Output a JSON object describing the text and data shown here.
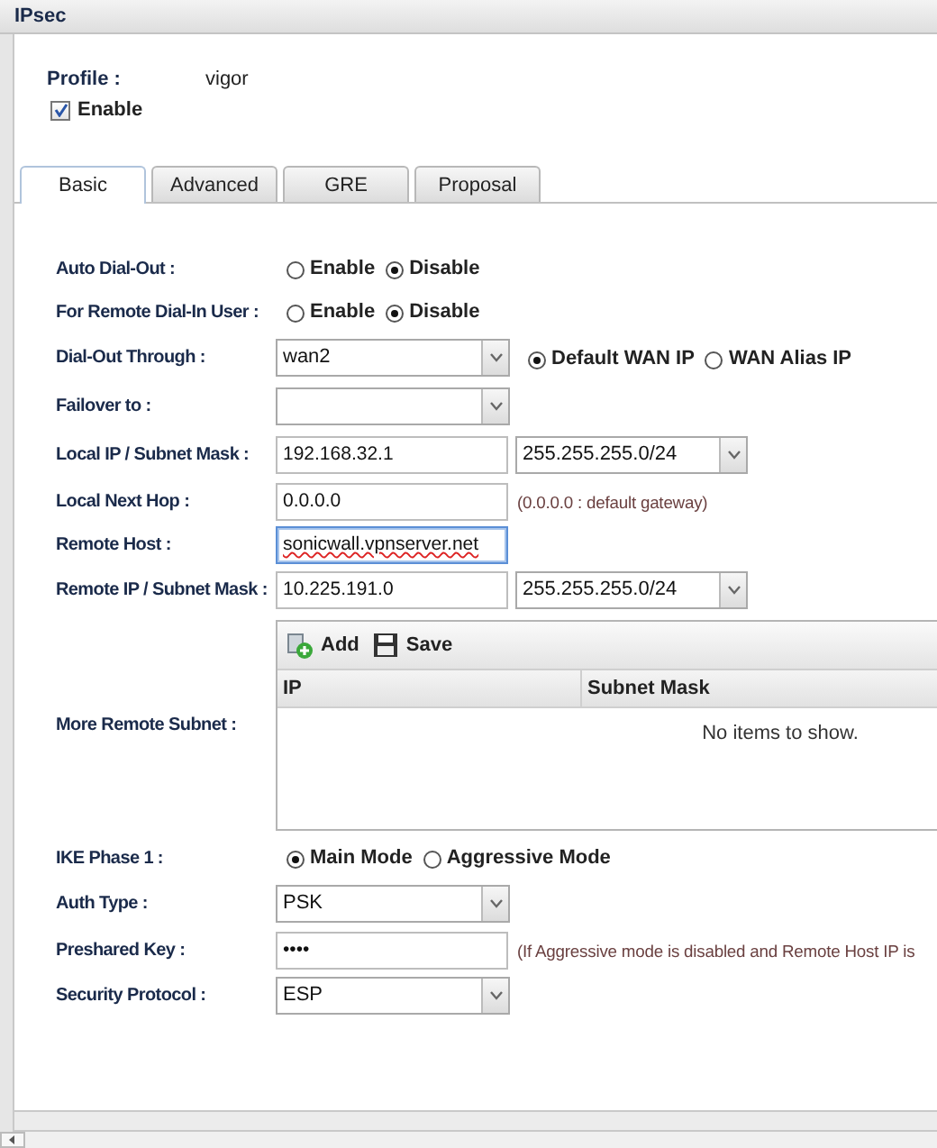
{
  "window": {
    "title": "IPsec"
  },
  "profile": {
    "label": "Profile :",
    "value": "vigor"
  },
  "enable": {
    "label": "Enable",
    "checked": true
  },
  "tabs": [
    {
      "label": "Basic",
      "selected": true
    },
    {
      "label": "Advanced",
      "selected": false
    },
    {
      "label": "GRE",
      "selected": false
    },
    {
      "label": "Proposal",
      "selected": false
    }
  ],
  "rows": [
    {
      "kind": "radios",
      "label": "Auto Dial-Out :",
      "options": [
        {
          "label": "Enable",
          "selected": false
        },
        {
          "label": "Disable",
          "selected": true
        }
      ]
    },
    {
      "kind": "radios",
      "label": "For Remote Dial-In User :",
      "options": [
        {
          "label": "Enable",
          "selected": false
        },
        {
          "label": "Disable",
          "selected": true
        }
      ]
    },
    {
      "kind": "select",
      "label": "Dial-Out Through :",
      "value": "wan2",
      "options": [
        {
          "label": "Default WAN IP",
          "selected": true
        },
        {
          "label": "WAN Alias IP",
          "selected": false
        }
      ]
    },
    {
      "kind": "select",
      "label": "Failover to :"
    },
    {
      "kind": "ip_mask",
      "label": "Local IP / Subnet Mask :",
      "value": "192.168.32.1",
      "mask": "255.255.255.0/24"
    },
    {
      "kind": "text",
      "label": "Local Next Hop :",
      "value": "0.0.0.0",
      "hint": "(0.0.0.0 : default gateway)"
    },
    {
      "kind": "text",
      "label": "Remote Host :",
      "value": "sonicwall.vpnserver.net",
      "focused": true,
      "misspelled": true
    },
    {
      "kind": "ip_mask",
      "label": "Remote IP / Subnet Mask :",
      "value": "10.225.191.0",
      "mask": "255.255.255.0/24"
    },
    {
      "kind": "grid",
      "label": "More Remote Subnet :",
      "toolbar": [
        {
          "kind": "add",
          "label": "Add"
        },
        {
          "kind": "save",
          "label": "Save"
        }
      ],
      "columns": [
        "IP",
        "Subnet Mask"
      ],
      "empty_text": "No items to show."
    },
    {
      "kind": "radios",
      "label": "IKE Phase 1 :",
      "options": [
        {
          "label": "Main Mode",
          "selected": true
        },
        {
          "label": "Aggressive Mode",
          "selected": false
        }
      ]
    },
    {
      "kind": "select",
      "label": "Auth Type :",
      "value": "PSK"
    },
    {
      "kind": "text",
      "label": "Preshared Key :",
      "value": "••••",
      "hint": "(If Aggressive mode is disabled and Remote Host IP is"
    },
    {
      "kind": "select",
      "label": "Security Protocol :",
      "value": "ESP"
    }
  ]
}
